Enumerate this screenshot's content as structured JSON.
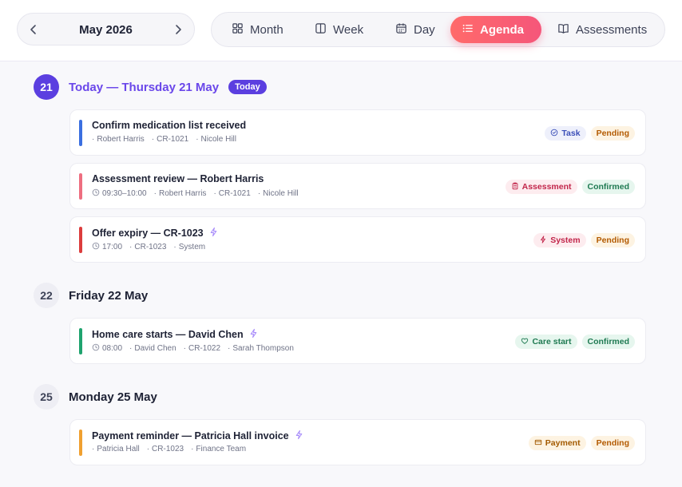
{
  "header": {
    "month_label": "May 2026",
    "views": [
      {
        "label": "Month",
        "icon": "grid-icon",
        "active": false
      },
      {
        "label": "Week",
        "icon": "columns-icon",
        "active": false
      },
      {
        "label": "Day",
        "icon": "calendar-icon",
        "active": false
      },
      {
        "label": "Agenda",
        "icon": "list-icon",
        "active": true
      },
      {
        "label": "Assessments",
        "icon": "book-icon",
        "active": false
      }
    ]
  },
  "days": [
    {
      "number": "21",
      "title": "Today — Thursday 21 May",
      "is_today": true,
      "badge": "Today",
      "events": [
        {
          "title": "Confirm medication list received",
          "accent_color": "#3b6fe0",
          "time": "",
          "meta": [
            "Robert Harris",
            "CR-1021",
            "Nicole Hill"
          ],
          "automated": false,
          "type": {
            "label": "Task",
            "icon": "check-circle-icon",
            "color": "#3b4fb8",
            "bg": "#eef0fb"
          },
          "status": {
            "label": "Pending",
            "color": "#b35a00",
            "bg": "#fdf3e2"
          }
        },
        {
          "title": "Assessment review — Robert Harris",
          "accent_color": "#ee6e80",
          "time": "09:30–10:00",
          "meta": [
            "Robert Harris",
            "CR-1021",
            "Nicole Hill"
          ],
          "automated": false,
          "type": {
            "label": "Assessment",
            "icon": "clipboard-icon",
            "color": "#c2264b",
            "bg": "#fdecef"
          },
          "status": {
            "label": "Confirmed",
            "color": "#1f7a52",
            "bg": "#e6f6ee"
          }
        },
        {
          "title": "Offer expiry — CR-1023",
          "accent_color": "#dc3d3d",
          "time": "17:00",
          "meta": [
            "CR-1023",
            "System"
          ],
          "automated": true,
          "type": {
            "label": "System",
            "icon": "lightning-icon",
            "color": "#c2264b",
            "bg": "#fdecef"
          },
          "status": {
            "label": "Pending",
            "color": "#b35a00",
            "bg": "#fdf3e2"
          }
        }
      ]
    },
    {
      "number": "22",
      "title": "Friday 22 May",
      "is_today": false,
      "badge": "",
      "events": [
        {
          "title": "Home care starts — David Chen",
          "accent_color": "#1fa36e",
          "time": "08:00",
          "meta": [
            "David Chen",
            "CR-1022",
            "Sarah Thompson"
          ],
          "automated": true,
          "type": {
            "label": "Care start",
            "icon": "heart-icon",
            "color": "#1f7a52",
            "bg": "#e6f6ee"
          },
          "status": {
            "label": "Confirmed",
            "color": "#1f7a52",
            "bg": "#e6f6ee"
          }
        }
      ]
    },
    {
      "number": "25",
      "title": "Monday 25 May",
      "is_today": false,
      "badge": "",
      "events": [
        {
          "title": "Payment reminder — Patricia Hall invoice",
          "accent_color": "#f0a030",
          "time": "",
          "meta": [
            "Patricia Hall",
            "CR-1023",
            "Finance Team"
          ],
          "automated": true,
          "type": {
            "label": "Payment",
            "icon": "card-icon",
            "color": "#a35a00",
            "bg": "#fdf3e2"
          },
          "status": {
            "label": "Pending",
            "color": "#b35a00",
            "bg": "#fdf3e2"
          }
        }
      ]
    }
  ]
}
